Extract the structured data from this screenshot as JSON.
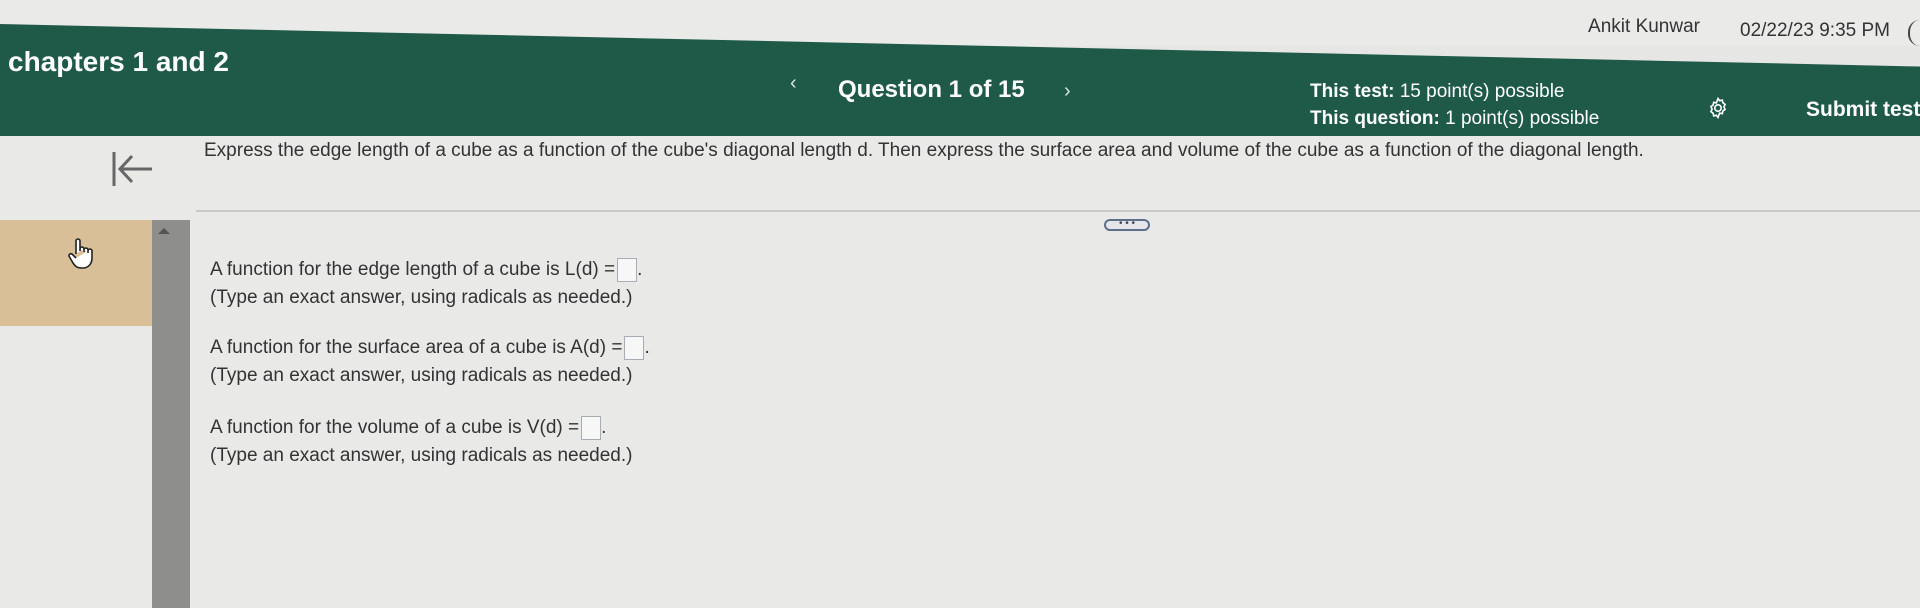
{
  "userbar": {
    "user_name": "Ankit Kunwar",
    "datetime": "02/22/23 9:35 PM"
  },
  "header": {
    "title": "chapters 1 and 2",
    "question_label": "Question 1 of 15",
    "test_points_label": "This test:",
    "test_points_value": "15 point(s) possible",
    "question_points_label": "This question:",
    "question_points_value": "1 point(s) possible",
    "submit_label": "Submit test",
    "prev_glyph": "‹",
    "next_glyph": "›"
  },
  "question": {
    "prompt": "Express the edge length of a cube as a function of the cube's diagonal length d. Then express the surface area and volume of the cube as a function of the diagonal length.",
    "more_label": "• • •",
    "parts": [
      {
        "text": "A function for the edge length of a cube is",
        "expr": "L(d) =",
        "note": "(Type an exact answer, using radicals as needed.)"
      },
      {
        "text": "A function for the surface area of a cube is",
        "expr": "A(d) =",
        "note": "(Type an exact answer, using radicals as needed.)"
      },
      {
        "text": "A function for the volume of a cube is",
        "expr": "V(d) =",
        "note": "(Type an exact answer, using radicals as needed.)"
      }
    ]
  },
  "colors": {
    "header_bg": "#1f5a48",
    "side_tab": "#d8bf98",
    "page_bg": "#e9e9e7"
  },
  "icons": {
    "back": "collapse-left-arrow-icon",
    "settings": "gear-icon",
    "pointer": "hand-pointer-icon"
  }
}
